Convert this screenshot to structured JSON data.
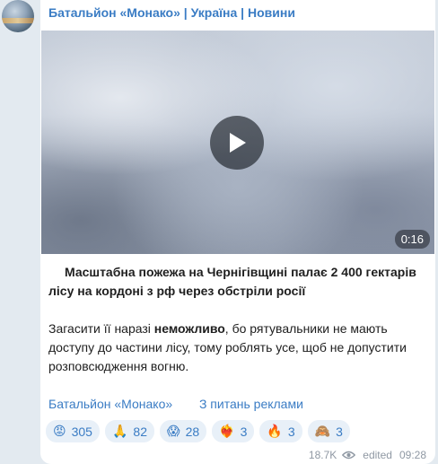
{
  "channel": {
    "name": "Батальйон «Монако» | Україна | Новини"
  },
  "video": {
    "duration": "0:16"
  },
  "post": {
    "headline": "Масштабна пожежа на Чернігівщині палає 2 400 гектарів лісу на кордоні з рф через обстріли росії",
    "body_prefix": "Загасити її наразі ",
    "body_bold": "неможливо",
    "body_suffix": ", бо рятувальники не мають доступу до частини лісу, тому роблять усе, щоб не допустити розповсюдження вогню."
  },
  "links": [
    {
      "label": "Батальйон «Монако»"
    },
    {
      "label": "З питань реклами"
    }
  ],
  "reactions": [
    {
      "emoji": "😡",
      "count": "305",
      "icon": "angry-face-icon"
    },
    {
      "emoji": "🙏",
      "count": "82",
      "icon": "folded-hands-icon"
    },
    {
      "emoji": "😱",
      "count": "28",
      "icon": "screaming-face-icon"
    },
    {
      "emoji": "❤️‍🔥",
      "count": "3",
      "icon": "heart-on-fire-icon"
    },
    {
      "emoji": "🔥",
      "count": "3",
      "icon": "fire-icon"
    },
    {
      "emoji": "🙈",
      "count": "3",
      "icon": "see-no-evil-monkey-icon"
    }
  ],
  "footer": {
    "views": "18.7K",
    "edited": "edited",
    "time": "09:28"
  },
  "colors": {
    "accent": "#3a7cc4",
    "background": "#e3eaf0",
    "reaction_bg": "#e8f0f8"
  }
}
